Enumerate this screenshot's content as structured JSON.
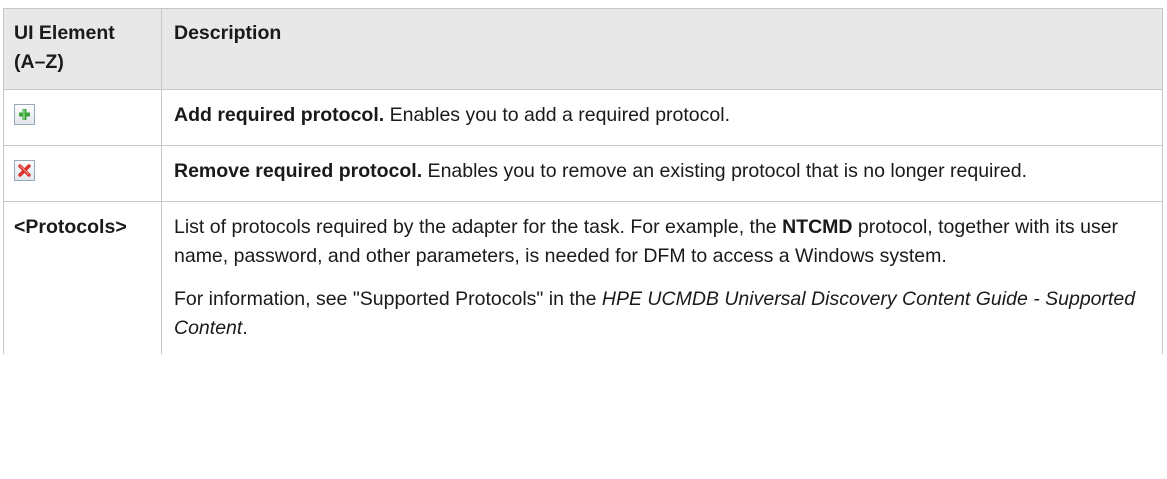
{
  "table": {
    "headers": {
      "element": "UI Element (A–Z)",
      "description": "Description"
    },
    "rows": [
      {
        "element_icon": "add-icon",
        "desc_bold": "Add required protocol.",
        "desc_rest": " Enables you to add a required protocol."
      },
      {
        "element_icon": "remove-icon",
        "desc_bold": "Remove required protocol.",
        "desc_rest": " Enables you to remove an existing protocol that is no longer required."
      },
      {
        "element_text": "<Protocols>",
        "p1_a": "List of protocols required by the adapter for the task. For example, the ",
        "p1_bold": "NTCMD",
        "p1_b": " protocol, together with its user name, password, and other parameters, is needed for DFM to access a Windows system.",
        "p2_a": "For information, see \"Supported Protocols\" in the ",
        "p2_ital": "HPE UCMDB Universal Discovery Content Guide - Supported Content",
        "p2_b": "."
      }
    ]
  },
  "colors": {
    "header_bg": "#e8e8e8",
    "border": "#c8c8c8",
    "add_green": "#3da33d",
    "remove_red": "#d9312b"
  }
}
